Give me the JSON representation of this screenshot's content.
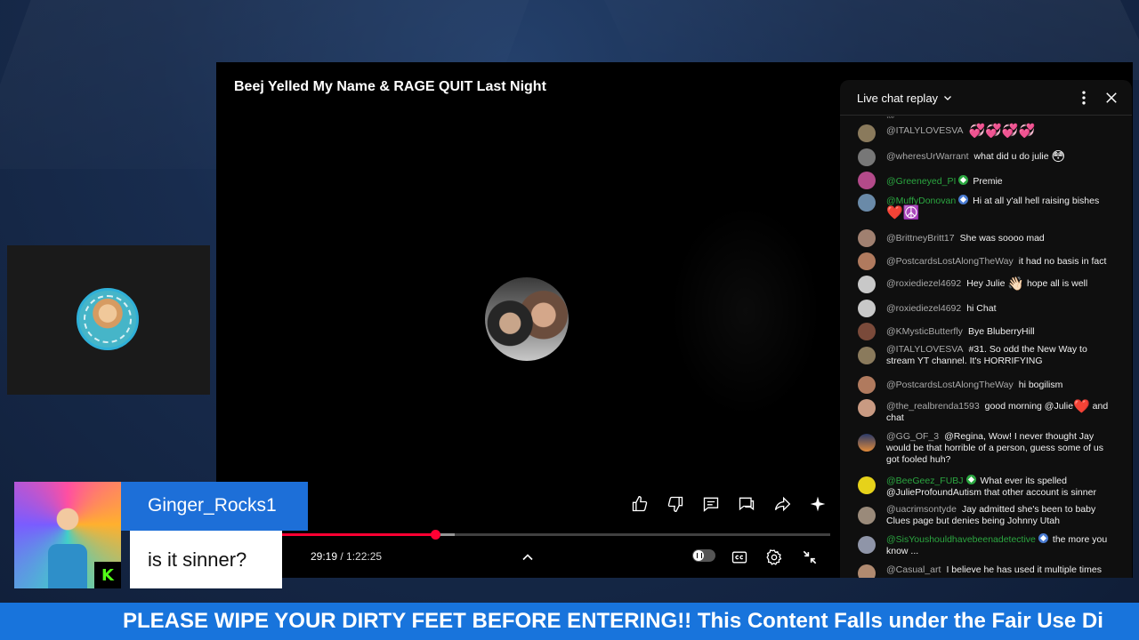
{
  "player": {
    "title": "Beej Yelled My Name & RAGE QUIT Last Night",
    "current_time": "29:19",
    "duration": "1:22:25",
    "progress_fraction": 0.356,
    "buffered_fraction": 0.388
  },
  "icons": {
    "like": "thumbs-up-icon",
    "dislike": "thumbs-down-icon",
    "comments": "comment-icon",
    "live_chat": "chat-icon",
    "share": "share-icon",
    "ask": "sparkle-icon",
    "expand": "chevron-up-icon",
    "autoplay": "pause-toggle-icon",
    "captions": "cc-icon",
    "settings": "gear-icon",
    "exit_fullscreen": "exit-fullscreen-icon"
  },
  "chat": {
    "title": "Live chat replay",
    "messages": [
      {
        "author": "@ITALYLOVESVA",
        "text": "",
        "emoji": "💞💞💞💞",
        "green": false
      },
      {
        "author": "@wheresUrWarrant",
        "text": "what did u do julie",
        "emoji": "😳",
        "green": false
      },
      {
        "author": "@Greeneyed_PI",
        "text": "Premie",
        "emoji": "",
        "green": true
      },
      {
        "author": "@MuffyDonovan",
        "text": "Hi at all y'all hell raising bishes",
        "emoji": "❤️☮️",
        "green": true
      },
      {
        "author": "@BrittneyBritt17",
        "text": "She was soooo mad",
        "emoji": "",
        "green": false
      },
      {
        "author": "@PostcardsLostAlongTheWay",
        "text": "it had no basis in fact",
        "emoji": "",
        "green": false
      },
      {
        "author": "@roxiediezel4692",
        "text": "Hey Julie",
        "emoji": "👋🏻",
        "text2": "hope all is well",
        "green": false
      },
      {
        "author": "@roxiediezel4692",
        "text": "hi Chat",
        "emoji": "",
        "green": false
      },
      {
        "author": "@KMysticButterfly",
        "text": "Bye BluberryHill",
        "emoji": "",
        "green": false
      },
      {
        "author": "@ITALYLOVESVA",
        "text": "#31. So odd the New Way to stream YT channel. It's HORRIFYING",
        "emoji": "",
        "green": false
      },
      {
        "author": "@PostcardsLostAlongTheWay",
        "text": "hi bogilism",
        "emoji": "",
        "green": false
      },
      {
        "author": "@the_realbrenda1593",
        "text": "good morning @Julie",
        "emoji": "❤️",
        "text2": "and chat",
        "green": false
      },
      {
        "author": "@GG_OF_3",
        "text": "@Regina, Wow! I never thought Jay would be that horrible of a person, guess some of us got fooled huh?",
        "emoji": "",
        "green": false
      },
      {
        "author": "@BeeGeez_FUBJ",
        "text": "What ever its spelled @JulieProfoundAutism that other account is sinner",
        "emoji": "",
        "green": true
      },
      {
        "author": "@uacrimsontyde",
        "text": "Jay admitted she's been to baby Clues page but denies being Johnny Utah",
        "emoji": "",
        "green": false
      },
      {
        "author": "@SisYoushouldhavebeenadetective",
        "text": "the more you know ...",
        "emoji": "",
        "green": true
      },
      {
        "author": "@Casual_art",
        "text": "I believe he has used it multiple times",
        "emoji": "",
        "green": false
      }
    ]
  },
  "overlay": {
    "commenter_name": "Ginger_Rocks1",
    "comment": "is it sinner?",
    "platform_letter": "K",
    "ticker": "PLEASE WIPE YOUR DIRTY FEET BEFORE ENTERING!! This Content Falls under the Fair Use Di"
  },
  "colors": {
    "accent_red": "#ff0033",
    "ticker_blue": "#1874dc",
    "name_box_blue": "#1d6fd8",
    "member_green": "#2ba640"
  }
}
